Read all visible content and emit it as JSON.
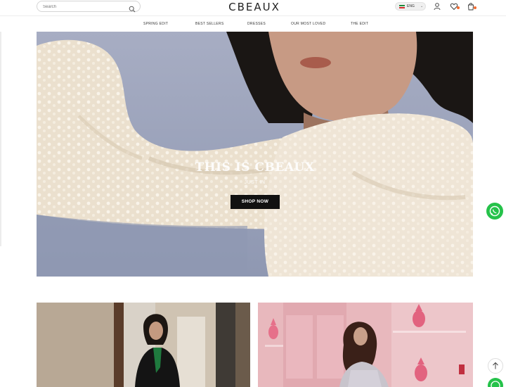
{
  "header": {
    "search_placeholder": "Search",
    "logo": "CBEAUX",
    "language_code": "ENG",
    "language_caret": "⌄",
    "icons": [
      "search-icon",
      "user-icon",
      "wishlist-icon",
      "cart-icon"
    ]
  },
  "nav": {
    "items": [
      "SPRING EDIT",
      "BEST SELLERS",
      "DRESSES",
      "OUR MOST LOVED",
      "THE EDIT"
    ]
  },
  "hero": {
    "title": "THIS IS CBEAUX",
    "subtitle": "JUST IN",
    "cta_label": "SHOP NOW"
  },
  "colors": {
    "accent": "#111111",
    "whatsapp": "#25c24a",
    "badge": "#f26b2f",
    "hero_sky": "#9aa2ba",
    "fabric": "#ece2d2"
  },
  "floating": {
    "whatsapp_icon": "whatsapp-icon",
    "back_to_top_icon": "arrow-up-icon"
  }
}
